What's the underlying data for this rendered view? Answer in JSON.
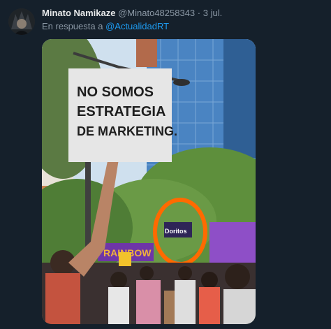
{
  "tweet": {
    "display_name": "Minato Namikaze",
    "handle": "@Minato48258343",
    "separator": "·",
    "date": "3 jul.",
    "reply_prefix": "En respuesta a",
    "reply_to": "@ActualidadRT"
  },
  "media": {
    "sign_lines": [
      "NO SOMOS",
      "ESTRATEGIA",
      "DE MARKETING."
    ],
    "banner_text": "RAINBOW",
    "brand_text": "Doritos",
    "highlight_color": "#ff6a00"
  },
  "icons": {
    "avatar": "avatar-icon"
  }
}
